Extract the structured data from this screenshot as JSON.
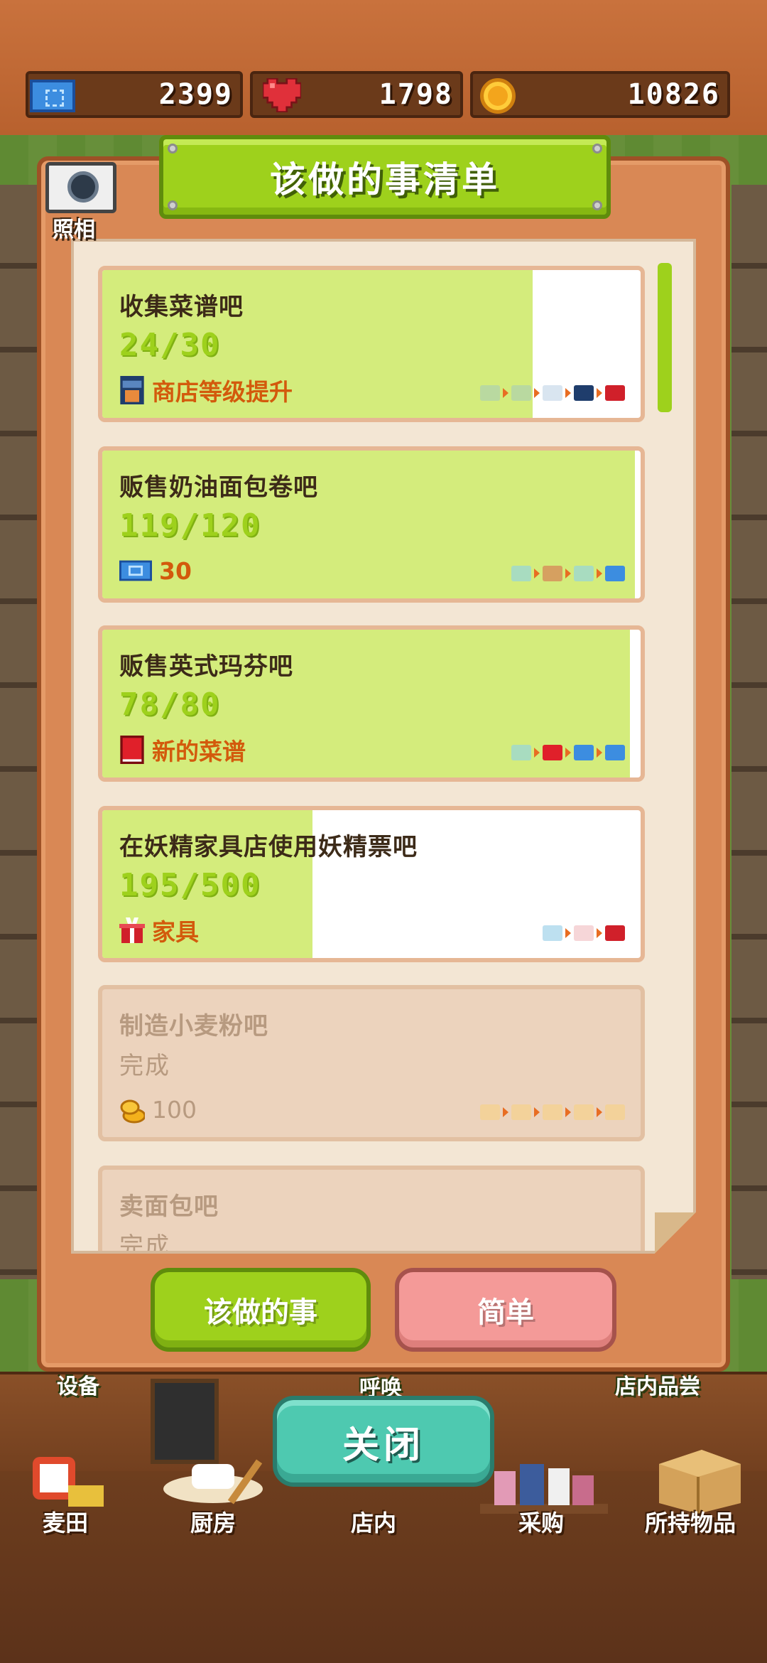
{
  "status": {
    "tickets": "2399",
    "hearts": "1798",
    "coins": "10826"
  },
  "panel": {
    "title": "该做的事清单",
    "camera_label": "照相"
  },
  "tasks": [
    {
      "title": "收集菜谱吧",
      "progress": "24/30",
      "fill_percent": 80,
      "reward": "商店等级提升",
      "reward_icon": "shop-icon",
      "completed": false
    },
    {
      "title": "贩售奶油面包卷吧",
      "progress": "119/120",
      "fill_percent": 99,
      "reward": "30",
      "reward_icon": "ticket-icon",
      "completed": false
    },
    {
      "title": "贩售英式玛芬吧",
      "progress": "78/80",
      "fill_percent": 98,
      "reward": "新的菜谱",
      "reward_icon": "recipe-book-icon",
      "completed": false
    },
    {
      "title": "在妖精家具店使用妖精票吧",
      "progress": "195/500",
      "fill_percent": 39,
      "reward": "家具",
      "reward_icon": "gift-icon",
      "completed": false
    },
    {
      "title": "制造小麦粉吧",
      "progress": "完成",
      "fill_percent": 100,
      "reward": "100",
      "reward_icon": "coin-stack-icon",
      "completed": true
    },
    {
      "title": "卖面包吧",
      "progress": "完成",
      "fill_percent": 100,
      "reward": "",
      "reward_icon": "",
      "completed": true
    }
  ],
  "tabs": {
    "todo": "该做的事",
    "simple": "简单"
  },
  "close_label": "关闭",
  "side_labels": {
    "equipment": "设备",
    "call": "呼唤",
    "tasting": "店内品尝"
  },
  "nav": {
    "field": "麦田",
    "kitchen": "厨房",
    "store": "店内",
    "purchase": "采购",
    "inventory": "所持物品"
  },
  "colors": {
    "accent_green": "#9ed11c",
    "progress_fill": "#d4ec7c",
    "reward_orange": "#d35a0c",
    "close_teal": "#4ec9b0",
    "simple_pink": "#f49a98"
  }
}
